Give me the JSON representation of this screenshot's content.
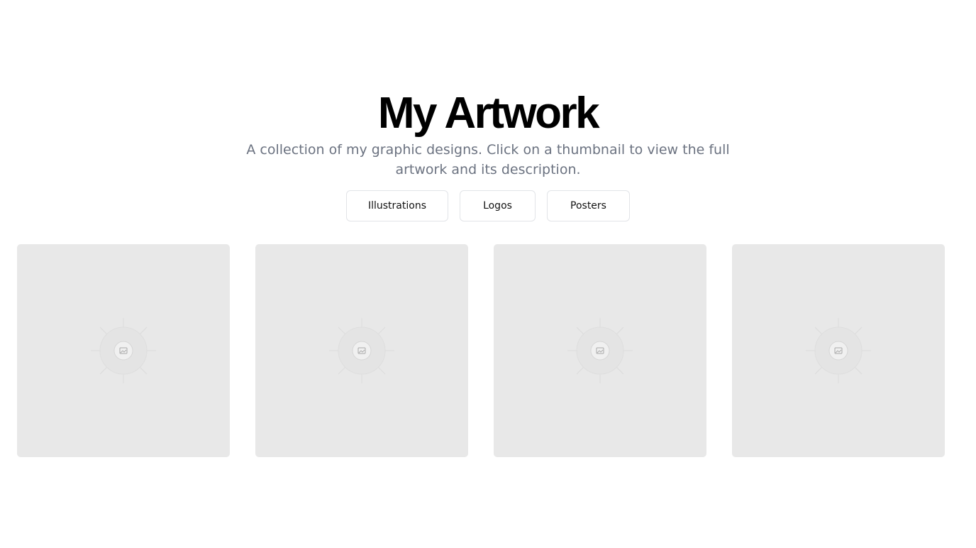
{
  "header": {
    "title": "My Artwork",
    "subtitle": "A collection of my graphic designs. Click on a thumbnail to view the full artwork and its description."
  },
  "filters": [
    {
      "label": "Illustrations"
    },
    {
      "label": "Logos"
    },
    {
      "label": "Posters"
    }
  ],
  "gallery": {
    "thumbnails": [
      {
        "icon": "image-placeholder-icon"
      },
      {
        "icon": "image-placeholder-icon"
      },
      {
        "icon": "image-placeholder-icon"
      },
      {
        "icon": "image-placeholder-icon"
      }
    ]
  },
  "colors": {
    "background": "#ffffff",
    "title": "#000000",
    "subtitle": "#6b7280",
    "button_border": "#e2e4e8",
    "thumbnail_bg": "#e8e8e8"
  }
}
